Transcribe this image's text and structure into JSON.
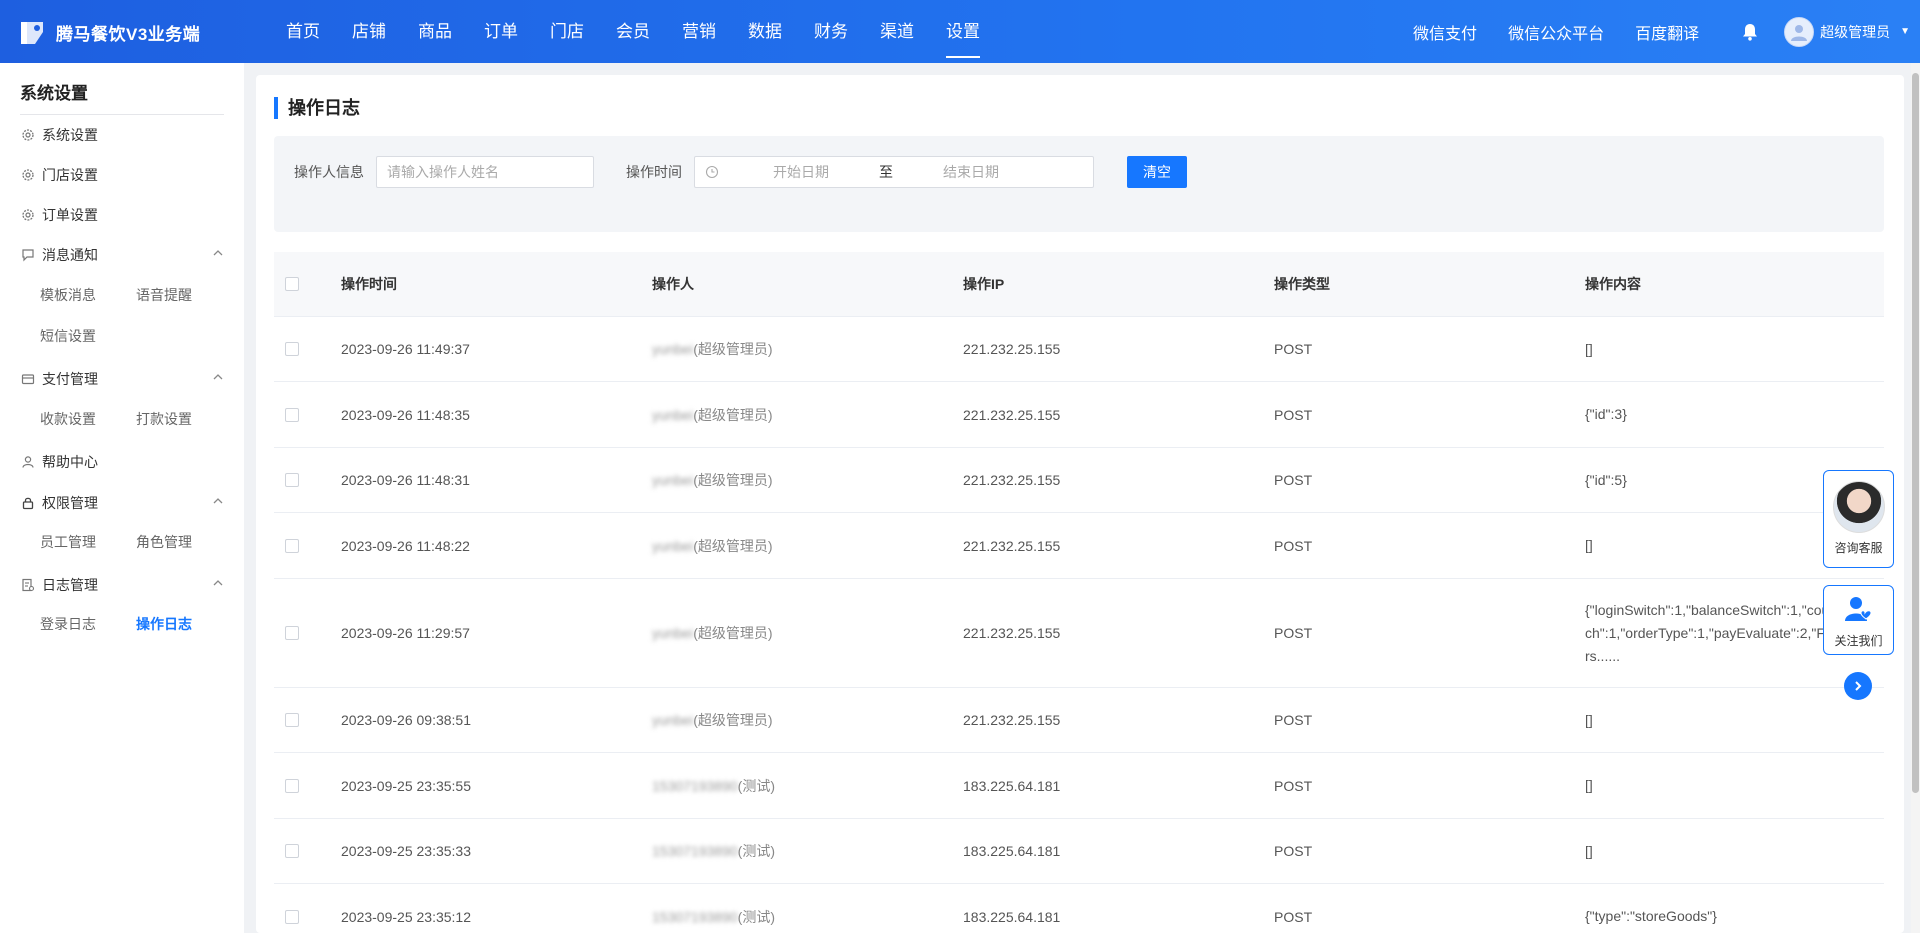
{
  "app": {
    "title": "腾马餐饮V3业务端"
  },
  "nav": {
    "items": [
      {
        "label": "首页"
      },
      {
        "label": "店铺"
      },
      {
        "label": "商品"
      },
      {
        "label": "订单"
      },
      {
        "label": "门店"
      },
      {
        "label": "会员"
      },
      {
        "label": "营销"
      },
      {
        "label": "数据"
      },
      {
        "label": "财务"
      },
      {
        "label": "渠道"
      },
      {
        "label": "设置",
        "active": true
      }
    ],
    "links": [
      {
        "label": "微信支付"
      },
      {
        "label": "微信公众平台"
      },
      {
        "label": "百度翻译"
      }
    ],
    "user": "超级管理员"
  },
  "sidebar": {
    "title": "系统设置",
    "items": [
      {
        "label": "系统设置",
        "icon": "gear-icon"
      },
      {
        "label": "门店设置",
        "icon": "gear-icon"
      },
      {
        "label": "订单设置",
        "icon": "gear-icon"
      },
      {
        "label": "消息通知",
        "icon": "chat-icon",
        "children": [
          "模板消息",
          "语音提醒",
          "短信设置"
        ]
      },
      {
        "label": "支付管理",
        "icon": "wallet-icon",
        "children": [
          "收款设置",
          "打款设置"
        ]
      },
      {
        "label": "帮助中心",
        "icon": "user-icon"
      },
      {
        "label": "权限管理",
        "icon": "lock-icon",
        "children": [
          "员工管理",
          "角色管理"
        ]
      },
      {
        "label": "日志管理",
        "icon": "log-icon",
        "children": [
          "登录日志",
          "操作日志"
        ]
      }
    ],
    "active_sub": "操作日志"
  },
  "page": {
    "title": "操作日志",
    "filter": {
      "operator_label": "操作人信息",
      "operator_placeholder": "请输入操作人姓名",
      "time_label": "操作时间",
      "start_placeholder": "开始日期",
      "separator": "至",
      "end_placeholder": "结束日期",
      "clear_label": "清空"
    },
    "table": {
      "columns": [
        "操作时间",
        "操作人",
        "操作IP",
        "操作类型",
        "操作内容"
      ],
      "rows": [
        {
          "time": "2023-09-26 11:49:37",
          "name": "yunbei",
          "role": "(超级管理员)",
          "ip": "221.232.25.155",
          "type": "POST",
          "content": "[]"
        },
        {
          "time": "2023-09-26 11:48:35",
          "name": "yunbei",
          "role": "(超级管理员)",
          "ip": "221.232.25.155",
          "type": "POST",
          "content": "{\"id\":3}"
        },
        {
          "time": "2023-09-26 11:48:31",
          "name": "yunbei",
          "role": "(超级管理员)",
          "ip": "221.232.25.155",
          "type": "POST",
          "content": "{\"id\":5}"
        },
        {
          "time": "2023-09-26 11:48:22",
          "name": "yunbei",
          "role": "(超级管理员)",
          "ip": "221.232.25.155",
          "type": "POST",
          "content": "[]"
        },
        {
          "time": "2023-09-26 11:29:57",
          "name": "yunbei",
          "role": "(超级管理员)",
          "ip": "221.232.25.155",
          "type": "POST",
          "content": "{\"loginSwitch\":1,\"balanceSwitch\":1,\"couponSwitch\":1,\"orderType\":1,\"payEvaluate\":2,\"Form\":{\"pers......"
        },
        {
          "time": "2023-09-26 09:38:51",
          "name": "yunbei",
          "role": "(超级管理员)",
          "ip": "221.232.25.155",
          "type": "POST",
          "content": "[]"
        },
        {
          "time": "2023-09-25 23:35:55",
          "name": "15307193890",
          "role": "(测试)",
          "ip": "183.225.64.181",
          "type": "POST",
          "content": "[]"
        },
        {
          "time": "2023-09-25 23:35:33",
          "name": "15307193890",
          "role": "(测试)",
          "ip": "183.225.64.181",
          "type": "POST",
          "content": "[]"
        },
        {
          "time": "2023-09-25 23:35:12",
          "name": "15307193890",
          "role": "(测试)",
          "ip": "183.225.64.181",
          "type": "POST",
          "content": "{\"type\":\"storeGoods\"}"
        }
      ]
    }
  },
  "float": {
    "service_label": "咨询客服",
    "follow_label": "关注我们"
  },
  "colors": {
    "primary": "#1677ff",
    "topbar": "#1e5fe0"
  }
}
